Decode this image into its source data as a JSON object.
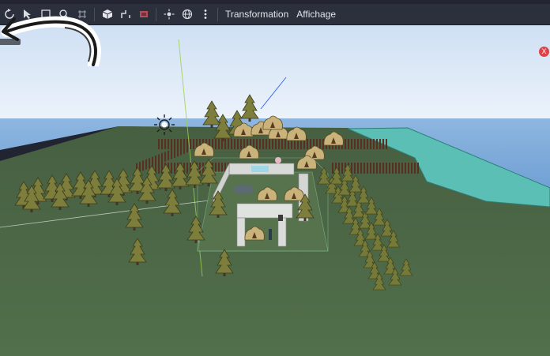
{
  "toolbar": {
    "buttons": [
      {
        "name": "rotate-view-icon"
      },
      {
        "name": "select-mode-icon"
      },
      {
        "name": "move-mode-icon"
      },
      {
        "name": "zoom-icon"
      },
      {
        "name": "snap-icon"
      },
      {
        "name": "cube-icon"
      },
      {
        "name": "bone-icon"
      },
      {
        "name": "group-icon"
      },
      {
        "name": "sun-icon"
      },
      {
        "name": "globe-icon"
      },
      {
        "name": "more-vertical-icon"
      }
    ],
    "menu_transform": "Transformation",
    "menu_view": "Affichage"
  },
  "badge_close": "X",
  "colors": {
    "toolbar_bg": "#2c303c",
    "sky_top": "#cfdff1",
    "sky_bottom": "#eaf1f8",
    "ocean": "#7aa7dc",
    "grass": "#4b6646",
    "water_pool": "#5fc2b8",
    "close_badge": "#e0404a"
  }
}
